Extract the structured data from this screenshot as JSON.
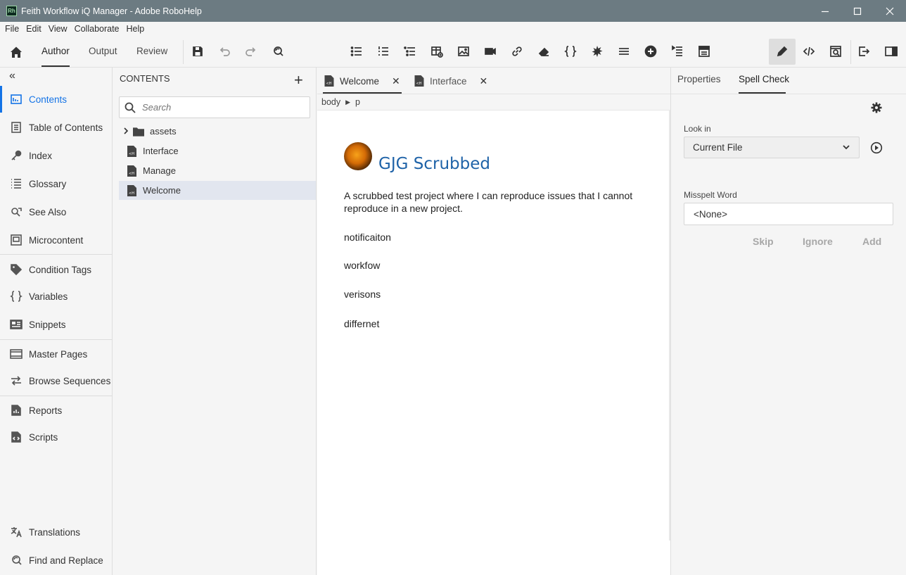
{
  "window": {
    "title": "Feith Workflow iQ Manager - Adobe RoboHelp",
    "app_icon_text": "Rh"
  },
  "menu": [
    "File",
    "Edit",
    "View",
    "Collaborate",
    "Help"
  ],
  "toolbar": {
    "modes": [
      "Author",
      "Output",
      "Review"
    ],
    "active_mode": "Author"
  },
  "leftnav": {
    "collapse_glyph": "«",
    "items": [
      {
        "label": "Contents",
        "icon": "contents-icon"
      },
      {
        "label": "Table of Contents",
        "icon": "toc-icon"
      },
      {
        "label": "Index",
        "icon": "key-icon"
      },
      {
        "label": "Glossary",
        "icon": "glossary-icon"
      },
      {
        "label": "See Also",
        "icon": "see-also-icon"
      },
      {
        "label": "Microcontent",
        "icon": "microcontent-icon"
      },
      {
        "label": "Condition Tags",
        "icon": "tag-icon"
      },
      {
        "label": "Variables",
        "icon": "braces-icon"
      },
      {
        "label": "Snippets",
        "icon": "snippet-icon"
      },
      {
        "label": "Master Pages",
        "icon": "master-page-icon"
      },
      {
        "label": "Browse Sequences",
        "icon": "sequence-icon"
      },
      {
        "label": "Reports",
        "icon": "report-icon"
      },
      {
        "label": "Scripts",
        "icon": "script-icon"
      },
      {
        "label": "Translations",
        "icon": "translate-icon"
      },
      {
        "label": "Find and Replace",
        "icon": "find-replace-icon"
      }
    ]
  },
  "contents_panel": {
    "title": "CONTENTS",
    "search_placeholder": "Search",
    "tree": [
      {
        "label": "assets",
        "type": "folder"
      },
      {
        "label": "Interface",
        "type": "file"
      },
      {
        "label": "Manage",
        "type": "file"
      },
      {
        "label": "Welcome",
        "type": "file",
        "selected": true
      }
    ]
  },
  "editor": {
    "tabs": [
      {
        "label": "Welcome",
        "active": true
      },
      {
        "label": "Interface",
        "active": false
      }
    ],
    "close_glyph": "✕",
    "breadcrumb": [
      "body",
      "p"
    ],
    "doc": {
      "title": "GJG Scrubbed",
      "intro": "A scrubbed test project where I can reproduce issues that I cannot reproduce in a new project.",
      "words": [
        "notificaiton",
        "workfow",
        "verisons",
        "differnet"
      ]
    }
  },
  "right_panel": {
    "tabs": [
      "Properties",
      "Spell Check"
    ],
    "active_tab": "Spell Check",
    "look_in_label": "Look in",
    "look_in_value": "Current File",
    "misspelt_label": "Misspelt Word",
    "misspelt_value": "<None>",
    "actions": [
      "Skip",
      "Ignore",
      "Add"
    ]
  },
  "colors": {
    "titlebar": "#6c7b82",
    "accent": "#1473e6",
    "heading": "#1f63a8"
  }
}
